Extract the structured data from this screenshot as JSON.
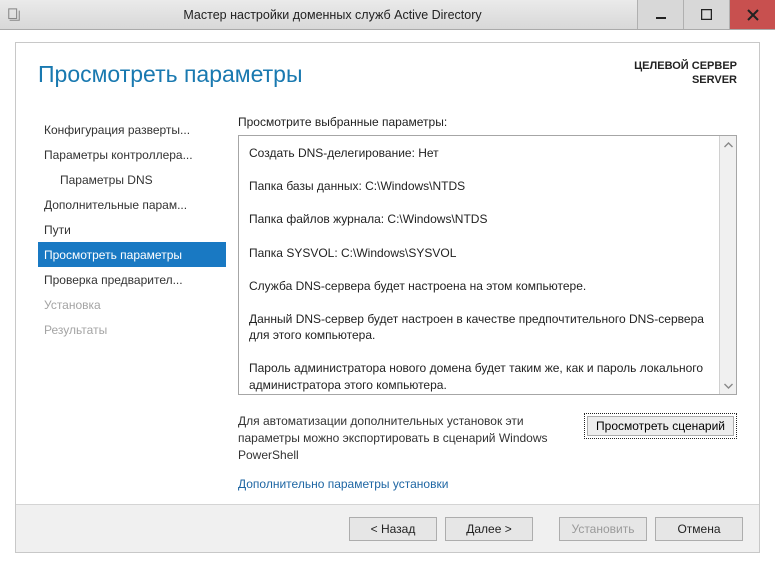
{
  "window": {
    "title": "Мастер настройки доменных служб Active Directory"
  },
  "page": {
    "title": "Просмотреть параметры",
    "target_label": "ЦЕЛЕВОЙ СЕРВЕР",
    "target_value": "SERVER"
  },
  "sidebar": {
    "items": [
      {
        "label": "Конфигурация разверты...",
        "indent": 0,
        "state": "normal"
      },
      {
        "label": "Параметры контроллера...",
        "indent": 0,
        "state": "normal"
      },
      {
        "label": "Параметры DNS",
        "indent": 1,
        "state": "normal"
      },
      {
        "label": "Дополнительные парам...",
        "indent": 0,
        "state": "normal"
      },
      {
        "label": "Пути",
        "indent": 0,
        "state": "normal"
      },
      {
        "label": "Просмотреть параметры",
        "indent": 0,
        "state": "selected"
      },
      {
        "label": "Проверка предварител...",
        "indent": 0,
        "state": "normal"
      },
      {
        "label": "Установка",
        "indent": 0,
        "state": "disabled"
      },
      {
        "label": "Результаты",
        "indent": 0,
        "state": "disabled"
      }
    ]
  },
  "main": {
    "label": "Просмотрите выбранные параметры:",
    "lines": [
      "Создать DNS-делегирование: Нет",
      "Папка базы данных: C:\\Windows\\NTDS",
      "Папка файлов журнала: C:\\Windows\\NTDS",
      "Папка SYSVOL: C:\\Windows\\SYSVOL",
      "Служба DNS-сервера будет настроена на этом компьютере.",
      "Данный DNS-сервер будет настроен в качестве предпочтительного DNS-сервера для этого компьютера.",
      "Пароль администратора нового домена будет таким же, как и пароль локального администратора этого компьютера."
    ],
    "hint_text": "Для автоматизации дополнительных установок эти параметры можно экспортировать в сценарий Windows PowerShell",
    "hint_button": "Просмотреть сценарий",
    "more_link": "Дополнительно параметры установки"
  },
  "footer": {
    "back": "< Назад",
    "next": "Далее >",
    "install": "Установить",
    "cancel": "Отмена"
  }
}
